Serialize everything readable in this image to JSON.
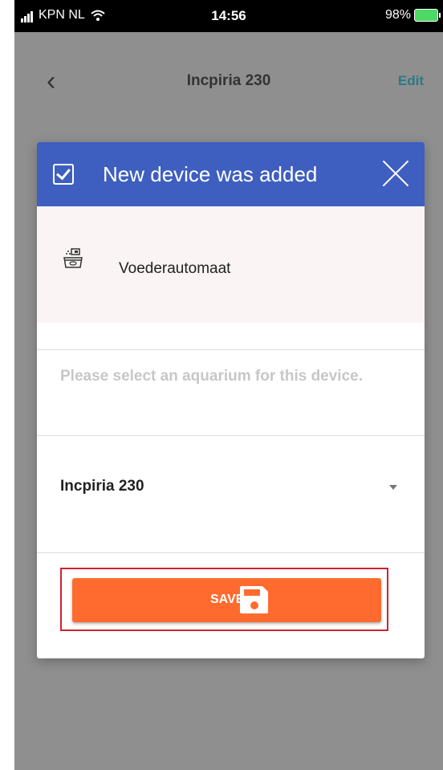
{
  "status_bar": {
    "carrier": "KPN NL",
    "time": "14:56",
    "battery": "98%"
  },
  "nav": {
    "back_symbol": "‹",
    "title": "Incpiria 230",
    "edit": "Edit"
  },
  "modal": {
    "title": "New device was added",
    "device_name": "Voederautomaat",
    "help_text": "Please select an aquarium for this device.",
    "selected_aquarium": "Incpiria 230",
    "save_label": "SAVE"
  },
  "colors": {
    "header": "#3e5fbf",
    "save": "#ff6b2f",
    "highlight": "#d12030"
  }
}
